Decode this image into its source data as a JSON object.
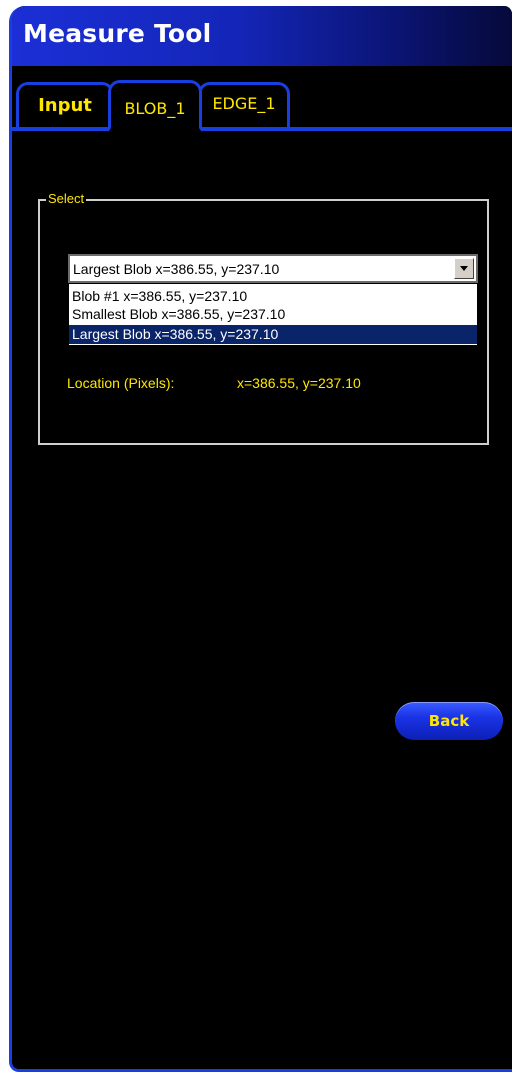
{
  "window": {
    "title": "Measure Tool"
  },
  "tabs": [
    {
      "label": "Input"
    },
    {
      "label": "BLOB_1"
    },
    {
      "label": "EDGE_1"
    }
  ],
  "select_group": {
    "label": "Select",
    "combo_value": "Largest Blob   x=386.55, y=237.10",
    "options": [
      {
        "label": "Blob #1   x=386.55, y=237.10"
      },
      {
        "label": "Smallest Blob   x=386.55, y=237.10"
      },
      {
        "label": "Largest Blob   x=386.55, y=237.10"
      }
    ],
    "location_label": "Location (Pixels):",
    "location_value": "x=386.55, y=237.10"
  },
  "buttons": {
    "back_label": "Back"
  },
  "colors": {
    "accent_blue": "#1a3fe0",
    "label_yellow": "#ffe600",
    "selection": "#0a246a"
  }
}
